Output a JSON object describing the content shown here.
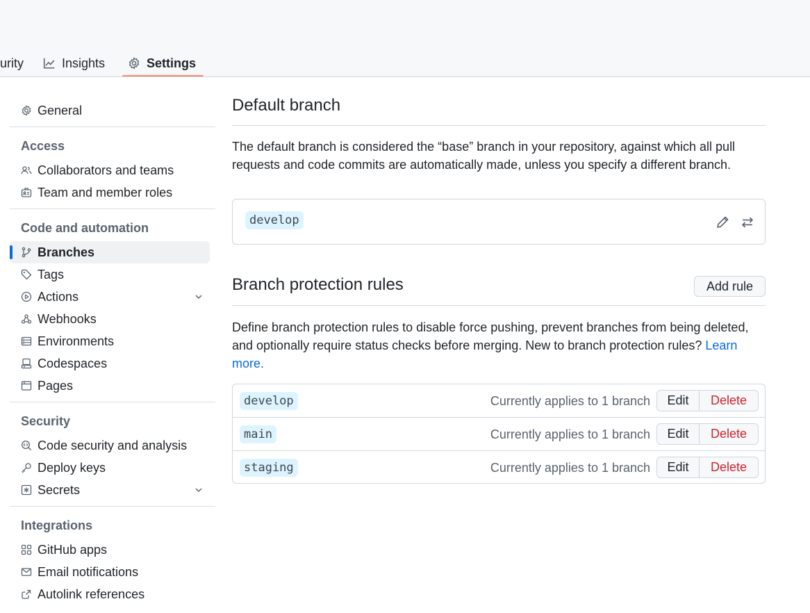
{
  "tabs": [
    {
      "label": "urity",
      "icon": "shield-icon"
    },
    {
      "label": "Insights",
      "icon": "graph-icon"
    },
    {
      "label": "Settings",
      "icon": "gear-icon"
    }
  ],
  "sidebar": {
    "general": {
      "label": "General",
      "icon": "gear-icon"
    },
    "sections": [
      {
        "title": "Access",
        "items": [
          {
            "label": "Collaborators and teams",
            "icon": "people-icon"
          },
          {
            "label": "Team and member roles",
            "icon": "id-badge-icon"
          }
        ]
      },
      {
        "title": "Code and automation",
        "items": [
          {
            "label": "Branches",
            "icon": "git-branch-icon",
            "selected": true
          },
          {
            "label": "Tags",
            "icon": "tag-icon"
          },
          {
            "label": "Actions",
            "icon": "play-icon",
            "expandable": true
          },
          {
            "label": "Webhooks",
            "icon": "webhook-icon"
          },
          {
            "label": "Environments",
            "icon": "server-icon"
          },
          {
            "label": "Codespaces",
            "icon": "codespaces-icon"
          },
          {
            "label": "Pages",
            "icon": "browser-icon"
          }
        ]
      },
      {
        "title": "Security",
        "items": [
          {
            "label": "Code security and analysis",
            "icon": "codescan-icon"
          },
          {
            "label": "Deploy keys",
            "icon": "key-icon"
          },
          {
            "label": "Secrets",
            "icon": "key-asterisk-icon",
            "expandable": true
          }
        ]
      },
      {
        "title": "Integrations",
        "items": [
          {
            "label": "GitHub apps",
            "icon": "apps-icon"
          },
          {
            "label": "Email notifications",
            "icon": "mail-icon"
          },
          {
            "label": "Autolink references",
            "icon": "cross-reference-icon"
          }
        ]
      }
    ]
  },
  "default_branch": {
    "heading": "Default branch",
    "description": "The default branch is considered the “base” branch in your repository, against which all pull requests and code commits are automatically made, unless you specify a different branch.",
    "branch": "develop",
    "icons": [
      "pencil-icon",
      "arrow-switch-icon"
    ]
  },
  "protection": {
    "heading": "Branch protection rules",
    "add_rule_label": "Add rule",
    "description": "Define branch protection rules to disable force pushing, prevent branches from being deleted, and optionally require status checks before merging. New to branch protection rules?",
    "learn_more": "Learn more.",
    "rules": [
      {
        "branch": "develop",
        "applies": "Currently applies to 1 branch",
        "edit": "Edit",
        "delete": "Delete"
      },
      {
        "branch": "main",
        "applies": "Currently applies to 1 branch",
        "edit": "Edit",
        "delete": "Delete"
      },
      {
        "branch": "staging",
        "applies": "Currently applies to 1 branch",
        "edit": "Edit",
        "delete": "Delete"
      }
    ]
  },
  "colors": {
    "accent": "#0969da",
    "danger": "#cf222e",
    "tab_underline": "#fd8c73",
    "code_chip_bg": "#ddf4ff"
  }
}
